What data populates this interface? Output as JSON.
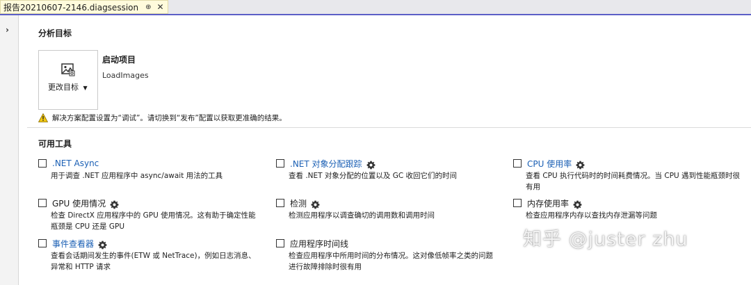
{
  "tab": {
    "title": "报告20210607-2146.diagsession",
    "pin": "⊕",
    "close": "✕"
  },
  "rail": {
    "chevron": "›"
  },
  "analysis": {
    "heading": "分析目标",
    "change_target_label": "更改目标",
    "startup_label": "启动项目",
    "project_name": "LoadImages",
    "warning": "解决方案配置设置为“调试”。请切换到“发布”配置以获取更准确的结果。"
  },
  "tools_section": {
    "heading": "可用工具",
    "tools": [
      {
        "name": ".NET Async",
        "link": true,
        "gear": false,
        "desc": "用于调查 .NET 应用程序中 async/await 用法的工具"
      },
      {
        "name": ".NET 对象分配跟踪",
        "link": true,
        "gear": true,
        "desc": "查看 .NET 对象分配的位置以及 GC 收回它们的时间"
      },
      {
        "name": "CPU 使用率",
        "link": true,
        "gear": true,
        "desc": "查看 CPU 执行代码时的时间耗费情况。当 CPU 遇到性能瓶颈时很有用"
      },
      {
        "name": "GPU 使用情况",
        "link": false,
        "gear": true,
        "desc": "检查 DirectX 应用程序中的 GPU 使用情况。这有助于确定性能瓶颈是 CPU 还是 GPU"
      },
      {
        "name": "检测",
        "link": false,
        "gear": true,
        "desc": "检测应用程序以调查确切的调用数和调用时间"
      },
      {
        "name": "内存使用率",
        "link": false,
        "gear": true,
        "desc": "检查应用程序内存以查找内存泄漏等问题"
      },
      {
        "name": "事件查看器",
        "link": true,
        "gear": true,
        "desc": "查看会话期间发生的事件(ETW 或 NetTrace)，例如日志消息、异常和 HTTP 请求"
      },
      {
        "name": "应用程序时间线",
        "link": false,
        "gear": false,
        "desc": "检查应用程序中所用时间的分布情况。这对像低帧率之类的问题进行故障排除时很有用"
      }
    ]
  },
  "watermark": "知乎 @juster zhu"
}
